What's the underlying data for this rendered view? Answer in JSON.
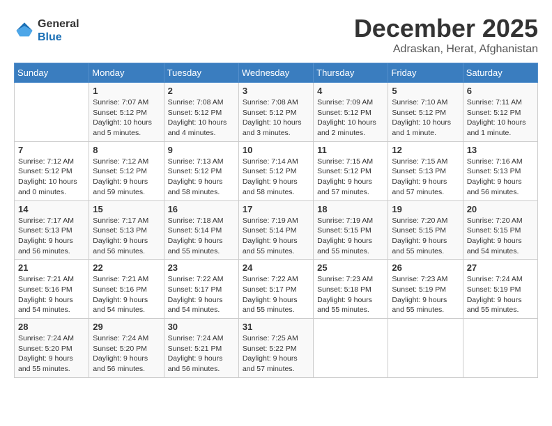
{
  "header": {
    "logo_line1": "General",
    "logo_line2": "Blue",
    "month": "December 2025",
    "location": "Adraskan, Herat, Afghanistan"
  },
  "days_of_week": [
    "Sunday",
    "Monday",
    "Tuesday",
    "Wednesday",
    "Thursday",
    "Friday",
    "Saturday"
  ],
  "weeks": [
    [
      {
        "day": "",
        "info": ""
      },
      {
        "day": "1",
        "info": "Sunrise: 7:07 AM\nSunset: 5:12 PM\nDaylight: 10 hours\nand 5 minutes."
      },
      {
        "day": "2",
        "info": "Sunrise: 7:08 AM\nSunset: 5:12 PM\nDaylight: 10 hours\nand 4 minutes."
      },
      {
        "day": "3",
        "info": "Sunrise: 7:08 AM\nSunset: 5:12 PM\nDaylight: 10 hours\nand 3 minutes."
      },
      {
        "day": "4",
        "info": "Sunrise: 7:09 AM\nSunset: 5:12 PM\nDaylight: 10 hours\nand 2 minutes."
      },
      {
        "day": "5",
        "info": "Sunrise: 7:10 AM\nSunset: 5:12 PM\nDaylight: 10 hours\nand 1 minute."
      },
      {
        "day": "6",
        "info": "Sunrise: 7:11 AM\nSunset: 5:12 PM\nDaylight: 10 hours\nand 1 minute."
      }
    ],
    [
      {
        "day": "7",
        "info": "Sunrise: 7:12 AM\nSunset: 5:12 PM\nDaylight: 10 hours\nand 0 minutes."
      },
      {
        "day": "8",
        "info": "Sunrise: 7:12 AM\nSunset: 5:12 PM\nDaylight: 9 hours\nand 59 minutes."
      },
      {
        "day": "9",
        "info": "Sunrise: 7:13 AM\nSunset: 5:12 PM\nDaylight: 9 hours\nand 58 minutes."
      },
      {
        "day": "10",
        "info": "Sunrise: 7:14 AM\nSunset: 5:12 PM\nDaylight: 9 hours\nand 58 minutes."
      },
      {
        "day": "11",
        "info": "Sunrise: 7:15 AM\nSunset: 5:12 PM\nDaylight: 9 hours\nand 57 minutes."
      },
      {
        "day": "12",
        "info": "Sunrise: 7:15 AM\nSunset: 5:13 PM\nDaylight: 9 hours\nand 57 minutes."
      },
      {
        "day": "13",
        "info": "Sunrise: 7:16 AM\nSunset: 5:13 PM\nDaylight: 9 hours\nand 56 minutes."
      }
    ],
    [
      {
        "day": "14",
        "info": "Sunrise: 7:17 AM\nSunset: 5:13 PM\nDaylight: 9 hours\nand 56 minutes."
      },
      {
        "day": "15",
        "info": "Sunrise: 7:17 AM\nSunset: 5:13 PM\nDaylight: 9 hours\nand 56 minutes."
      },
      {
        "day": "16",
        "info": "Sunrise: 7:18 AM\nSunset: 5:14 PM\nDaylight: 9 hours\nand 55 minutes."
      },
      {
        "day": "17",
        "info": "Sunrise: 7:19 AM\nSunset: 5:14 PM\nDaylight: 9 hours\nand 55 minutes."
      },
      {
        "day": "18",
        "info": "Sunrise: 7:19 AM\nSunset: 5:15 PM\nDaylight: 9 hours\nand 55 minutes."
      },
      {
        "day": "19",
        "info": "Sunrise: 7:20 AM\nSunset: 5:15 PM\nDaylight: 9 hours\nand 55 minutes."
      },
      {
        "day": "20",
        "info": "Sunrise: 7:20 AM\nSunset: 5:15 PM\nDaylight: 9 hours\nand 54 minutes."
      }
    ],
    [
      {
        "day": "21",
        "info": "Sunrise: 7:21 AM\nSunset: 5:16 PM\nDaylight: 9 hours\nand 54 minutes."
      },
      {
        "day": "22",
        "info": "Sunrise: 7:21 AM\nSunset: 5:16 PM\nDaylight: 9 hours\nand 54 minutes."
      },
      {
        "day": "23",
        "info": "Sunrise: 7:22 AM\nSunset: 5:17 PM\nDaylight: 9 hours\nand 54 minutes."
      },
      {
        "day": "24",
        "info": "Sunrise: 7:22 AM\nSunset: 5:17 PM\nDaylight: 9 hours\nand 55 minutes."
      },
      {
        "day": "25",
        "info": "Sunrise: 7:23 AM\nSunset: 5:18 PM\nDaylight: 9 hours\nand 55 minutes."
      },
      {
        "day": "26",
        "info": "Sunrise: 7:23 AM\nSunset: 5:19 PM\nDaylight: 9 hours\nand 55 minutes."
      },
      {
        "day": "27",
        "info": "Sunrise: 7:24 AM\nSunset: 5:19 PM\nDaylight: 9 hours\nand 55 minutes."
      }
    ],
    [
      {
        "day": "28",
        "info": "Sunrise: 7:24 AM\nSunset: 5:20 PM\nDaylight: 9 hours\nand 55 minutes."
      },
      {
        "day": "29",
        "info": "Sunrise: 7:24 AM\nSunset: 5:20 PM\nDaylight: 9 hours\nand 56 minutes."
      },
      {
        "day": "30",
        "info": "Sunrise: 7:24 AM\nSunset: 5:21 PM\nDaylight: 9 hours\nand 56 minutes."
      },
      {
        "day": "31",
        "info": "Sunrise: 7:25 AM\nSunset: 5:22 PM\nDaylight: 9 hours\nand 57 minutes."
      },
      {
        "day": "",
        "info": ""
      },
      {
        "day": "",
        "info": ""
      },
      {
        "day": "",
        "info": ""
      }
    ]
  ]
}
